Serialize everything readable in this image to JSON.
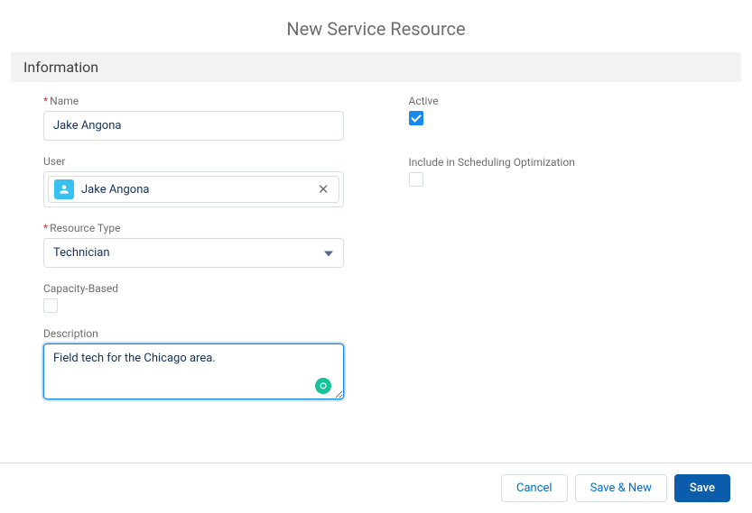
{
  "title": "New Service Resource",
  "section": "Information",
  "left": {
    "name": {
      "label": "Name",
      "value": "Jake Angona",
      "required": true
    },
    "user": {
      "label": "User",
      "value": "Jake Angona",
      "required": false
    },
    "resourceType": {
      "label": "Resource Type",
      "value": "Technician",
      "required": true
    },
    "capacityBased": {
      "label": "Capacity-Based",
      "checked": false
    },
    "description": {
      "label": "Description",
      "value": "Field tech for the Chicago area."
    }
  },
  "right": {
    "active": {
      "label": "Active",
      "checked": true
    },
    "includeOpt": {
      "label": "Include in Scheduling Optimization",
      "checked": false
    }
  },
  "footer": {
    "cancel": "Cancel",
    "saveNew": "Save & New",
    "save": "Save"
  },
  "requiredMark": "*"
}
